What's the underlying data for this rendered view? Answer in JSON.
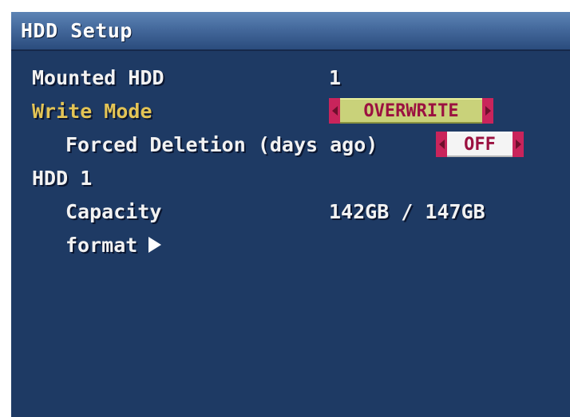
{
  "window": {
    "title": "HDD Setup"
  },
  "rows": {
    "mounted_hdd": {
      "label": "Mounted HDD",
      "value": "1"
    },
    "write_mode": {
      "label": "Write Mode",
      "value": "OVERWRITE"
    },
    "forced_deletion": {
      "label": "Forced Deletion (days ago)",
      "value": "OFF"
    },
    "hdd_section": {
      "label": "HDD 1"
    },
    "capacity": {
      "label": "Capacity",
      "value": "142GB / 147GB"
    },
    "format": {
      "label": "format"
    }
  },
  "colors": {
    "background": "#1e3a64",
    "title_bar": "#44699c",
    "active_label": "#e3c455",
    "selector_arrow": "#c9245b",
    "selector_text": "#9b1140",
    "overwrite_fill": "#c9d27a",
    "off_fill": "#f4f4f4"
  },
  "icons": {
    "selector_left": "caret-left-icon",
    "selector_right": "caret-right-icon",
    "format_submenu": "triangle-right-icon"
  }
}
